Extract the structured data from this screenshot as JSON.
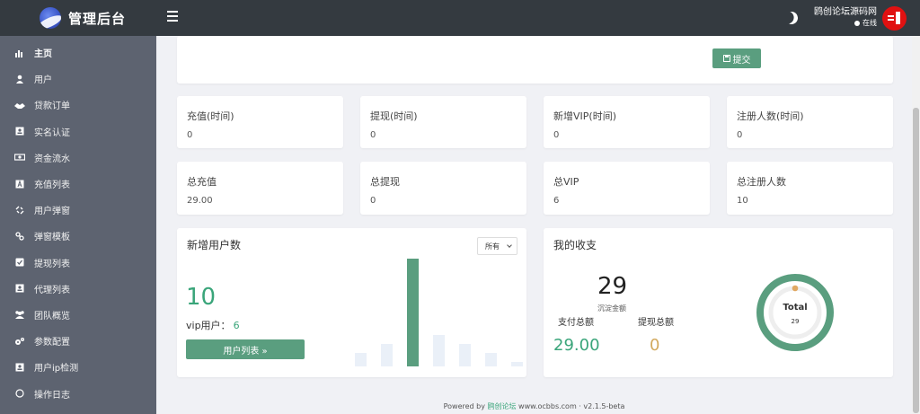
{
  "brand": {
    "title": "管理后台"
  },
  "sidebar": {
    "items": [
      {
        "label": "主页",
        "icon": "bar-chart-icon"
      },
      {
        "label": "用户",
        "icon": "user-icon"
      },
      {
        "label": "贷款订单",
        "icon": "handshake-icon"
      },
      {
        "label": "实名认证",
        "icon": "id-card-icon"
      },
      {
        "label": "资金流水",
        "icon": "money-icon"
      },
      {
        "label": "充值列表",
        "icon": "font-icon"
      },
      {
        "label": "用户弹窗",
        "icon": "unlink-icon"
      },
      {
        "label": "弹窗模板",
        "icon": "link-icon"
      },
      {
        "label": "提现列表",
        "icon": "check-square-icon"
      },
      {
        "label": "代理列表",
        "icon": "user-box-icon"
      },
      {
        "label": "团队概览",
        "icon": "users-icon"
      },
      {
        "label": "参数配置",
        "icon": "cogs-icon"
      },
      {
        "label": "用户ip检测",
        "icon": "user-box-icon"
      },
      {
        "label": "操作日志",
        "icon": "circle-icon"
      }
    ]
  },
  "topbar": {
    "user_name": "鸥创论坛源码网",
    "user_status": "在线"
  },
  "form": {
    "submit_label": "提交"
  },
  "stats_row1": [
    {
      "label": "充值(时间)",
      "value": "0"
    },
    {
      "label": "提现(时间)",
      "value": "0"
    },
    {
      "label": "新增VIP(时间)",
      "value": "0"
    },
    {
      "label": "注册人数(时间)",
      "value": "0"
    }
  ],
  "stats_row2": [
    {
      "label": "总充值",
      "value": "29.00"
    },
    {
      "label": "总提现",
      "value": "0"
    },
    {
      "label": "总VIP",
      "value": "6"
    },
    {
      "label": "总注册人数",
      "value": "10"
    }
  ],
  "new_users": {
    "title": "新增用户数",
    "filter_selected": "所有",
    "count": "10",
    "vip_label": "vip用户：",
    "vip_value": "6",
    "list_button": "用户列表 »"
  },
  "finance": {
    "title": "我的收支",
    "total": "29",
    "total_label": "沉淀金额",
    "pay_label": "支付总额",
    "withdraw_label": "提现总额",
    "pay_value": "29.00",
    "withdraw_value": "0",
    "ring_title": "Total",
    "ring_value": "29"
  },
  "chart_data": {
    "type": "bar",
    "categories": [
      "",
      "",
      "",
      "",
      "",
      "",
      ""
    ],
    "values": [
      1.5,
      2.5,
      12,
      3.5,
      2.5,
      1.5,
      0.5
    ],
    "highlight_index": 2,
    "title": "",
    "xlabel": "",
    "ylabel": "",
    "ylim": [
      0,
      12
    ]
  },
  "footer": {
    "prefix": "Powered by ",
    "site": "鸥创论坛",
    "url": " www.ocbbs.com",
    "version": " · v2.1.5-beta"
  },
  "colors": {
    "accent": "#5a9e7f",
    "green_text": "#3aa57a",
    "gold_text": "#d2a95e",
    "sidebar": "#5d6370",
    "topbar": "#343a40",
    "avatar": "#e01111"
  }
}
